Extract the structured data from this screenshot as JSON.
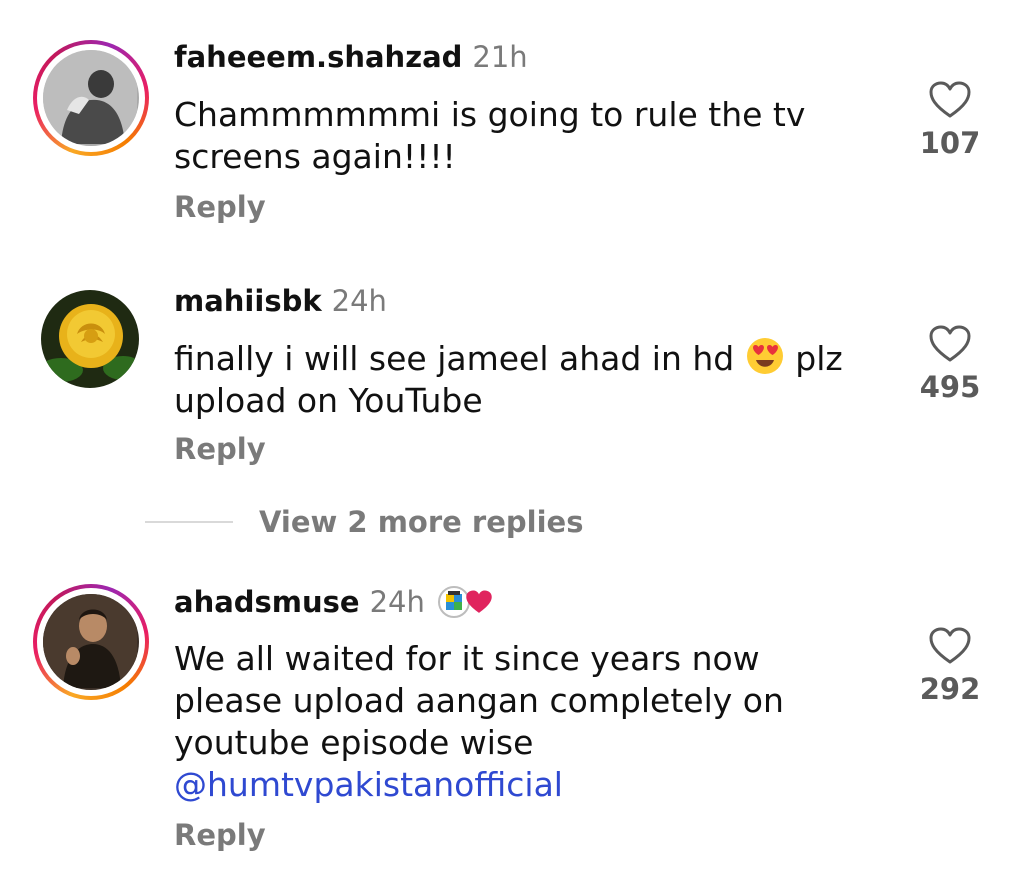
{
  "comments": [
    {
      "username": "faheeem.shahzad",
      "time": "21h",
      "text": "Chammmmmmi is going to rule the tv screens again!!!!",
      "reply_label": "Reply",
      "likes": "107",
      "avatar_icon": "person-photo-avatar",
      "has_story_ring": true
    },
    {
      "username": "mahiisbk",
      "time": "24h",
      "text_before_emoji": "finally i will see jameel ahad in hd",
      "emoji": "heart-eyes-emoji",
      "text_after_emoji": "plz upload on YouTube",
      "reply_label": "Reply",
      "likes": "495",
      "avatar_icon": "yellow-rose-avatar",
      "has_story_ring": false
    },
    {
      "username": "ahadsmuse",
      "time": "24h",
      "text": "We all waited for it since years now please upload aangan completely on youtube episode wise",
      "mention": "@humtvpakistanofficial",
      "reply_label": "Reply",
      "likes": "292",
      "avatar_icon": "person-photo-avatar",
      "badge_icons": [
        "hum-logo-icon",
        "red-heart-icon"
      ],
      "has_story_ring": true
    }
  ],
  "view_more": {
    "label": "View 2 more replies"
  },
  "colors": {
    "mention": "#2f49d1",
    "secondary_text": "#7a7a7a",
    "heart_badge": "#e0245e"
  }
}
